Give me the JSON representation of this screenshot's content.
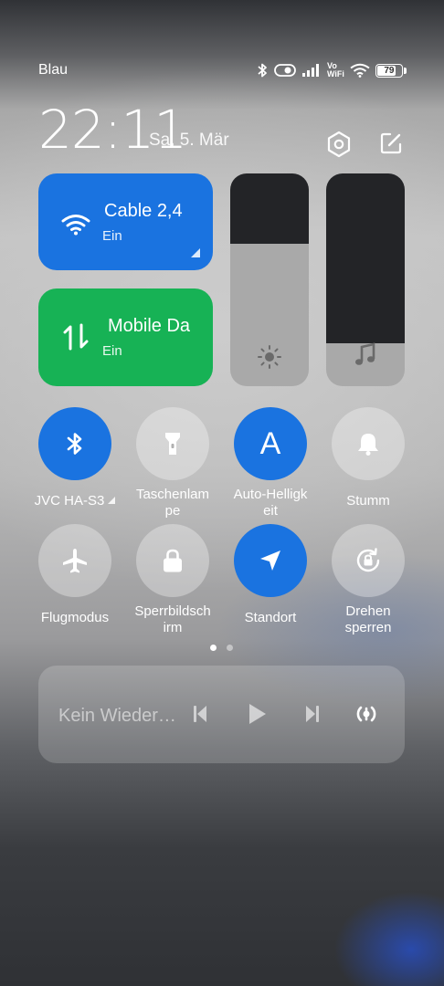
{
  "status_bar": {
    "carrier": "Blau",
    "volte_line1": "Vo",
    "volte_line2": "WiFi",
    "battery_percent": 79,
    "battery_label": "79",
    "icons": [
      "bluetooth-icon",
      "toggle-icon",
      "signal-icon",
      "volte-wifi-icon",
      "wifi-icon",
      "battery-icon"
    ]
  },
  "header": {
    "time": "22:11",
    "date": "Sa, 5. Mär",
    "settings_icon": "gear-hex-icon",
    "edit_icon": "edit-icon"
  },
  "tiles": {
    "wifi": {
      "title": "Cable 2,4",
      "status": "Ein",
      "icon": "wifi-icon",
      "color": "#1a73e0"
    },
    "mobile": {
      "title": "Mobile Da",
      "status": "Ein",
      "icon": "mobile-data-icon",
      "color": "#17b255"
    }
  },
  "sliders": {
    "brightness": {
      "level": 0.67,
      "icon": "sun-icon"
    },
    "volume": {
      "level": 0.2,
      "icon": "music-note-icon"
    }
  },
  "toggles": [
    {
      "label": "JVC HA-S3",
      "state": "on",
      "icon": "bluetooth-icon"
    },
    {
      "label": "Taschenlam\npe",
      "state": "off",
      "icon": "flashlight-icon"
    },
    {
      "label": "Auto-Helligk\neit",
      "state": "on",
      "icon": "letter-a-icon",
      "glyph": "A"
    },
    {
      "label": "Stumm",
      "state": "off",
      "icon": "bell-icon"
    },
    {
      "label": "Flugmodus",
      "state": "off",
      "icon": "airplane-icon"
    },
    {
      "label": "Sperrbildsch\nirm",
      "state": "off",
      "icon": "lock-icon"
    },
    {
      "label": "Standort",
      "state": "on",
      "icon": "location-arrow-icon"
    },
    {
      "label": "Drehen\nsperren",
      "state": "off",
      "icon": "rotation-lock-icon"
    }
  ],
  "pagination": {
    "current": 1,
    "total": 2
  },
  "media": {
    "title": "Kein Wieder…",
    "controls": [
      "previous-icon",
      "play-icon",
      "next-icon",
      "cast-icon"
    ]
  },
  "colors": {
    "accent_blue": "#1a73e0",
    "accent_green": "#17b255"
  }
}
